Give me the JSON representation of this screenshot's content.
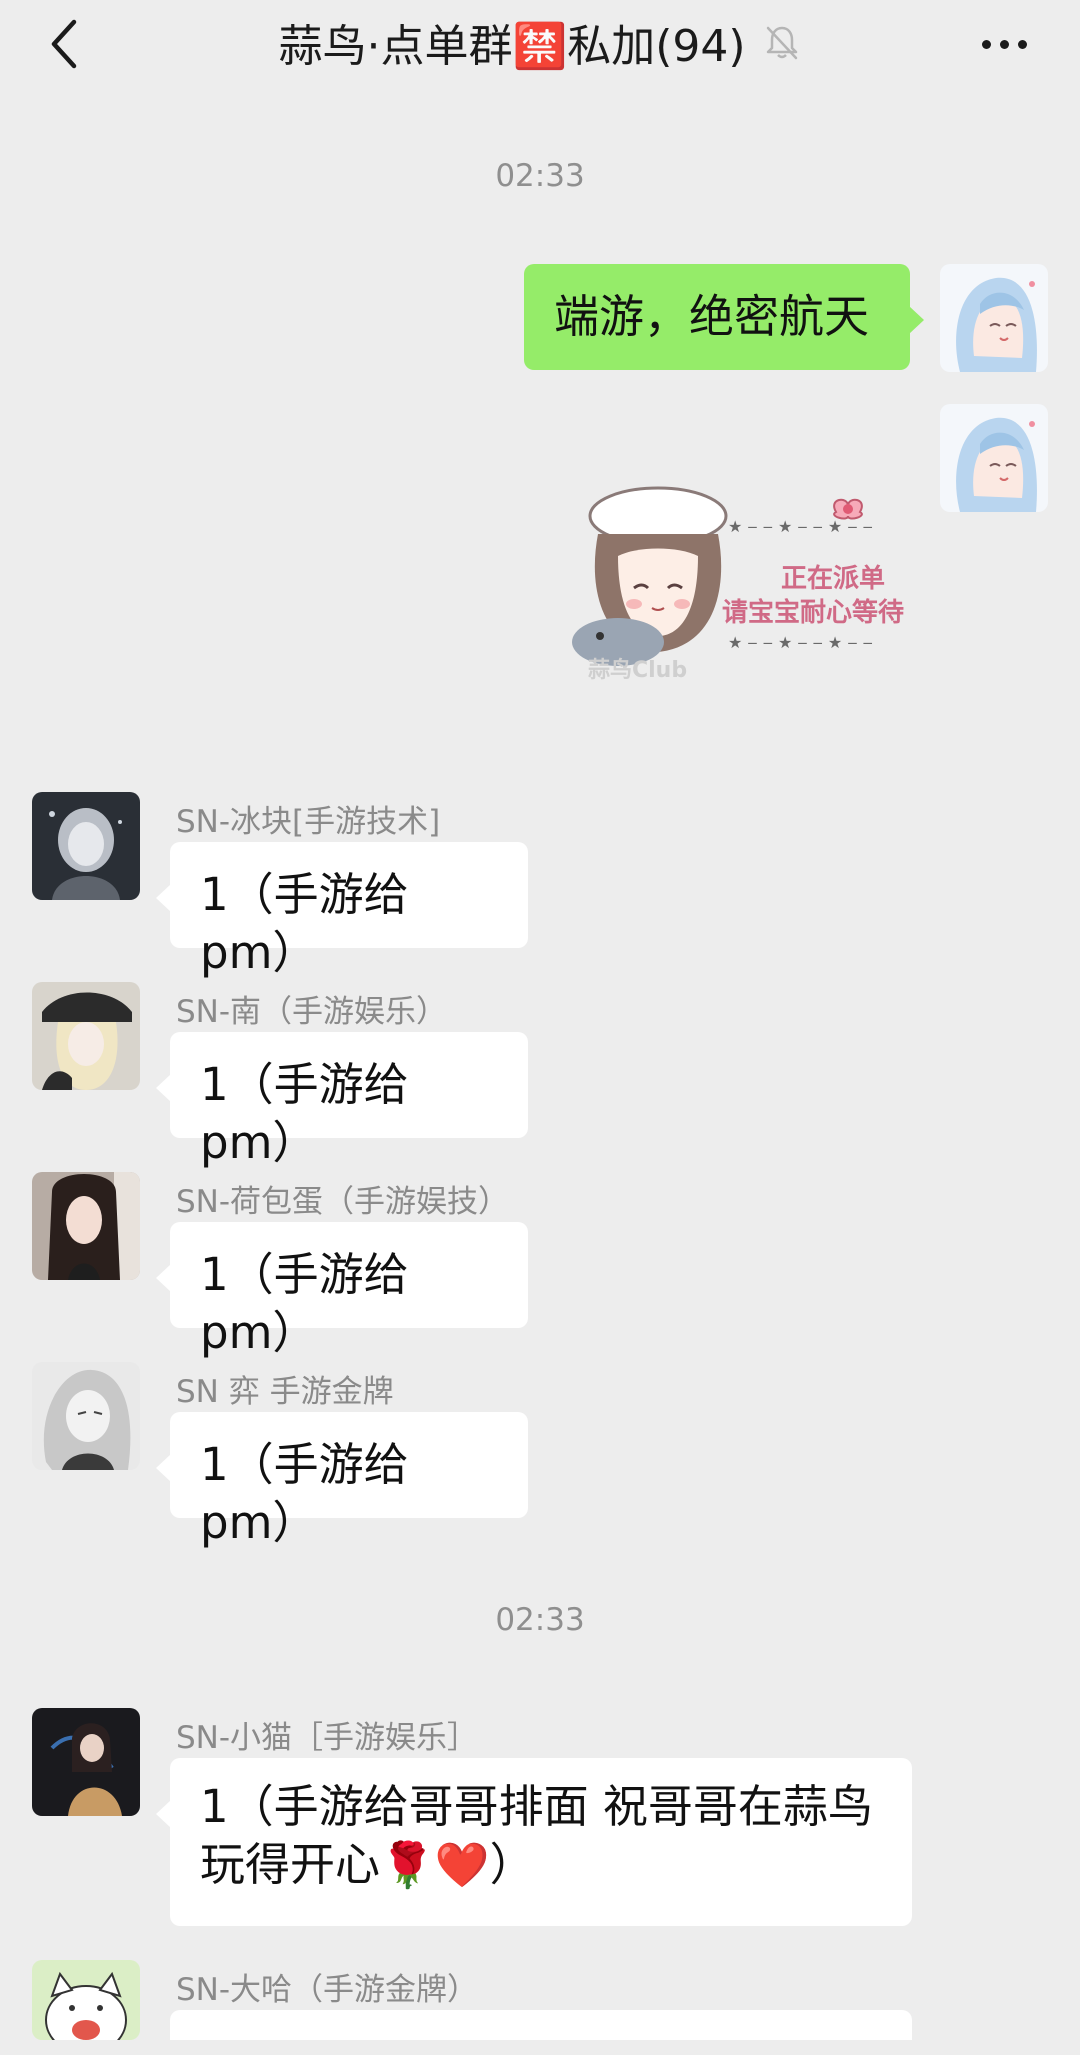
{
  "header": {
    "title": "蒜鸟·点单群🈲私加(94)",
    "back_icon": "chevron-left-icon",
    "mute_icon": "bell-slash-icon",
    "more_icon": "more-dots-icon"
  },
  "timestamps": [
    "02:33",
    "02:33"
  ],
  "outgoing": {
    "text_message": "端游，绝密航天",
    "sticker": {
      "line1": "正在派单",
      "line2": "请宝宝耐心等待",
      "watermark": "蒜鸟Club"
    }
  },
  "messages": [
    {
      "sender": "SN-冰块[手游技术]",
      "text": "1（手游给 pm）"
    },
    {
      "sender": "SN-南（手游娱乐）",
      "text": "1（手游给 pm）"
    },
    {
      "sender": "SN-荷包蛋（手游娱技）",
      "text": "1（手游给 pm）"
    },
    {
      "sender": "SN 弈 手游金牌",
      "text": "1（手游给 pm）"
    },
    {
      "sender": "SN-小猫［手游娱乐］",
      "text_line1": "1（手游给哥哥排面 祝哥哥在蒜鸟",
      "text_line2_prefix": "玩得开心",
      "text_line2_emoji": "🌹❤️",
      "text_line2_suffix": "）"
    },
    {
      "sender": "SN-大哈（手游金牌）"
    }
  ],
  "colors": {
    "background": "#ededed",
    "outgoing_bubble": "#95ec69",
    "incoming_bubble": "#ffffff",
    "meta_text": "#8f8f8f"
  }
}
